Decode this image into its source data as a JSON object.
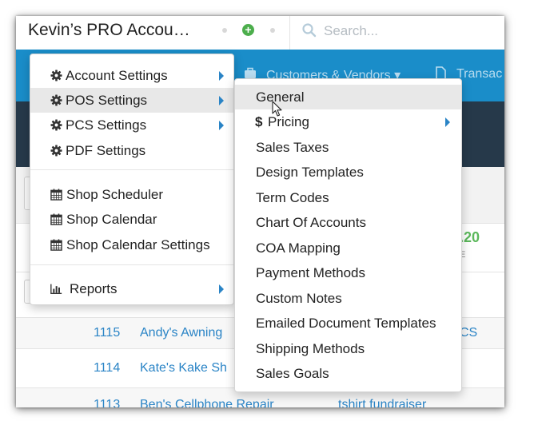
{
  "header": {
    "account_title": "Kevin’s PRO Accou…",
    "add_icon": "plus-circle-icon",
    "search": {
      "placeholder": "Search...",
      "value": "",
      "icon": "search-icon"
    }
  },
  "navbar": {
    "items": [
      {
        "label": "Customers & Vendors",
        "icon": "briefcase-icon",
        "has_dropdown": true
      },
      {
        "label": "Transac",
        "icon": "document-icon"
      }
    ]
  },
  "background_table": {
    "amount": "2.20",
    "rows": [
      {
        "number": "1115",
        "name": "Andy's Awning",
        "extra": "CS"
      },
      {
        "number": "1114",
        "name": "Kate's Kake Sh",
        "extra": ""
      },
      {
        "number": "1113",
        "name": "Ben's Cellphone Repair",
        "extra": "tshirt fundraiser"
      }
    ]
  },
  "main_menu": {
    "groups": [
      {
        "items": [
          {
            "label": "Account Settings",
            "icon": "gear-icon",
            "submenu": true
          },
          {
            "label": "POS Settings",
            "icon": "gear-icon",
            "submenu": true,
            "highlighted": true
          },
          {
            "label": "PCS Settings",
            "icon": "gear-icon",
            "submenu": true
          },
          {
            "label": "PDF Settings",
            "icon": "gear-icon",
            "submenu": false
          }
        ]
      },
      {
        "items": [
          {
            "label": "Shop Scheduler",
            "icon": "calendar-icon"
          },
          {
            "label": "Shop Calendar",
            "icon": "calendar-icon"
          },
          {
            "label": "Shop Calendar Settings",
            "icon": "calendar-icon"
          }
        ]
      },
      {
        "items": [
          {
            "label": "Reports",
            "icon": "bar-chart-icon",
            "submenu": true
          }
        ]
      }
    ]
  },
  "pos_submenu": {
    "items": [
      {
        "label": "General",
        "highlighted": true
      },
      {
        "label": "Pricing",
        "prefix": "$",
        "submenu": true
      },
      {
        "label": "Sales Taxes"
      },
      {
        "label": "Design Templates"
      },
      {
        "label": "Term Codes"
      },
      {
        "label": "Chart Of Accounts"
      },
      {
        "label": "COA Mapping"
      },
      {
        "label": "Payment Methods"
      },
      {
        "label": "Custom Notes"
      },
      {
        "label": "Emailed Document Templates"
      },
      {
        "label": "Shipping Methods"
      },
      {
        "label": "Sales Goals"
      }
    ]
  },
  "colors": {
    "navbar": "#1a8dc9",
    "dark_band": "#26394a",
    "link": "#2a84c6",
    "accent_green": "#5cb85c"
  }
}
